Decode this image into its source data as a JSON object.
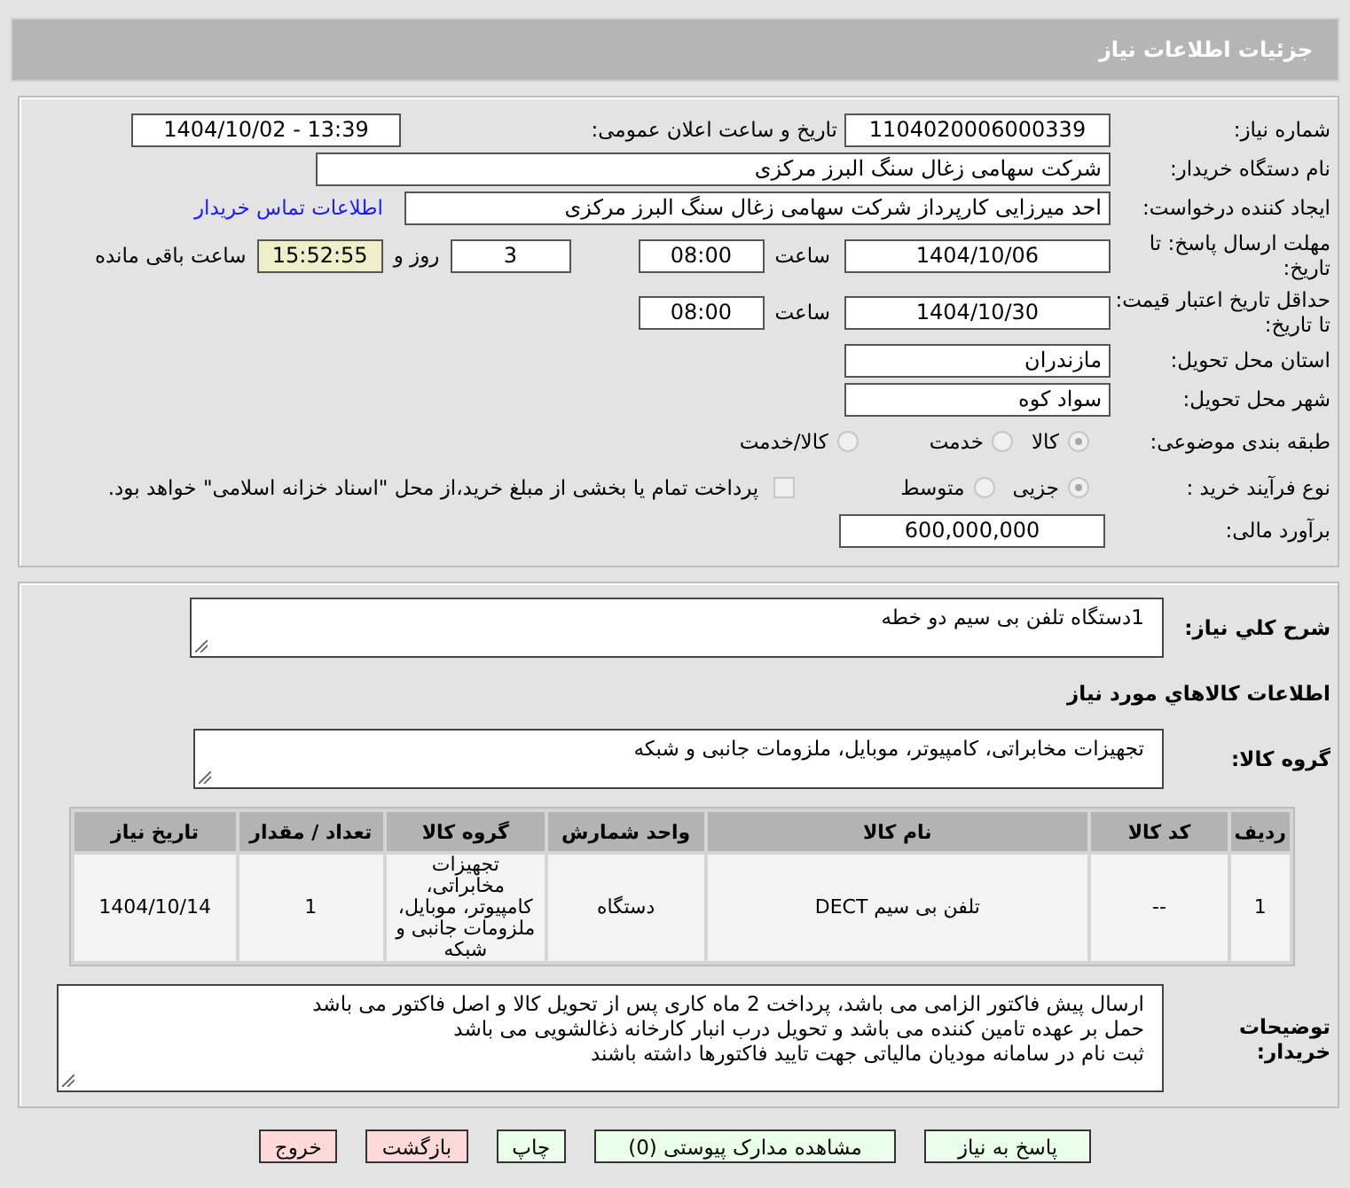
{
  "header": {
    "title": "جزئیات اطلاعات نیاز"
  },
  "need_number": {
    "label": "شماره نیاز:",
    "value": "1104020006000339"
  },
  "announce": {
    "label": "تاریخ و ساعت اعلان عمومی:",
    "value": "1404/10/02 - 13:39"
  },
  "buyer_org": {
    "label": "نام دستگاه خریدار:",
    "value": "شرکت سهامی زغال سنگ البرز مرکزی"
  },
  "requester": {
    "label": "ایجاد کننده درخواست:",
    "value": "احد میرزایی کارپرداز شرکت سهامی زغال سنگ البرز مرکزی",
    "link": "اطلاعات تماس خریدار"
  },
  "response_deadline": {
    "label": "مهلت ارسال پاسخ: تا تاریخ:",
    "date": "1404/10/06",
    "time_label": "ساعت",
    "time": "08:00",
    "days": "3",
    "days_label": "روز و",
    "remaining": "15:52:55",
    "remaining_label": "ساعت باقی مانده"
  },
  "price_validity": {
    "label": "حداقل تاریخ اعتبار قیمت: تا تاریخ:",
    "date": "1404/10/30",
    "time_label": "ساعت",
    "time": "08:00"
  },
  "province": {
    "label": "استان محل تحویل:",
    "value": "مازندران"
  },
  "city": {
    "label": "شهر محل تحویل:",
    "value": "سواد کوه"
  },
  "category": {
    "label": "طبقه بندی موضوعی:",
    "options": [
      {
        "label": "کالا",
        "selected": true
      },
      {
        "label": "خدمت",
        "selected": false
      },
      {
        "label": "کالا/خدمت",
        "selected": false
      }
    ]
  },
  "purchase_type": {
    "label": "نوع فرآیند خرید :",
    "options": [
      {
        "label": "جزیی",
        "selected": true
      },
      {
        "label": "متوسط",
        "selected": false
      }
    ],
    "treasury": {
      "checked": false,
      "text": "پرداخت تمام یا بخشی از مبلغ خرید،از محل \"اسناد خزانه اسلامی\" خواهد بود."
    }
  },
  "estimate": {
    "label": "برآورد مالی:",
    "value": "600,000,000"
  },
  "description": {
    "label": "شرح کلي نياز:",
    "value": "1دستگاه تلفن بی سیم دو خطه"
  },
  "goods_heading": "اطلاعات کالاهاي مورد نياز",
  "goods_group": {
    "label": "گروه کالا:",
    "value": "تجهیزات مخابراتی، کامپیوتر، موبایل، ملزومات جانبی و شبکه"
  },
  "table": {
    "columns": [
      "ردیف",
      "کد کالا",
      "نام کالا",
      "واحد شمارش",
      "گروه کالا",
      "تعداد / مقدار",
      "تاریخ نیاز"
    ],
    "rows": [
      {
        "cells": [
          "1",
          "--",
          "تلفن بی سیم DECT",
          "دستگاه",
          "تجهیزات مخابراتی، کامپیوتر، موبایل، ملزومات جانبی و شبکه",
          "1",
          "1404/10/14"
        ]
      }
    ]
  },
  "buyer_notes": {
    "label": "توضیحات خریدار:",
    "lines": [
      "ارسال پیش فاکتور الزامی می باشد، پرداخت 2 ماه کاری پس از تحویل کالا و اصل فاکتور می باشد",
      "حمل بر عهده تامین کننده می باشد و تحویل درب انبار کارخانه ذغالشویی می باشد",
      "ثبت نام در سامانه مودیان مالیاتی جهت تایید فاکتورها داشته باشند"
    ]
  },
  "buttons": [
    {
      "label": "پاسخ به نیاز",
      "kind": "action"
    },
    {
      "label": "مشاهده مدارک پیوستی (0)",
      "kind": "action"
    },
    {
      "label": "چاپ",
      "kind": "action"
    },
    {
      "label": "بازگشت",
      "kind": "exit"
    },
    {
      "label": "خروج",
      "kind": "exit"
    }
  ]
}
